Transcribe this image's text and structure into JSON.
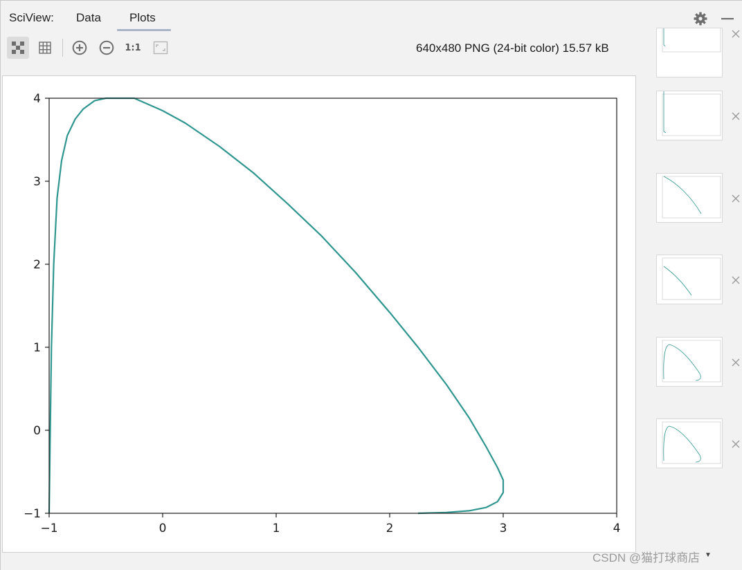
{
  "header": {
    "title": "SciView:",
    "tabs": [
      {
        "label": "Data",
        "active": false
      },
      {
        "label": "Plots",
        "active": true
      }
    ]
  },
  "toolbar": {
    "buttons": [
      {
        "icon": "checkerboard-icon",
        "active": true
      },
      {
        "icon": "grid-icon",
        "active": false
      },
      {
        "icon": "zoom-in-icon",
        "active": false
      },
      {
        "icon": "zoom-out-icon",
        "active": false
      },
      {
        "icon": "actual-size-icon",
        "label": "1:1",
        "active": false
      },
      {
        "icon": "fit-window-icon",
        "active": false
      }
    ],
    "image_info": "640x480 PNG (24-bit color) 15.57 kB"
  },
  "colors": {
    "accent": "#a9b4c6",
    "line": "#2e968f",
    "axis": "#1a1a1a",
    "icon": "#6e6e6e"
  },
  "chart_data": {
    "type": "line",
    "title": "",
    "xlabel": "",
    "ylabel": "",
    "xlim": [
      -1,
      4
    ],
    "ylim": [
      -1,
      4
    ],
    "xticks": [
      "−1",
      "0",
      "1",
      "2",
      "3",
      "4"
    ],
    "yticks": [
      "−1",
      "0",
      "1",
      "2",
      "3",
      "4"
    ],
    "grid": false,
    "series": [
      {
        "x": [
          -1.0,
          -0.99,
          -0.98,
          -0.96,
          -0.93,
          -0.89,
          -0.84,
          -0.77,
          -0.7,
          -0.6,
          -0.5,
          -0.25,
          0.0,
          0.2,
          0.5,
          0.8,
          1.1,
          1.4,
          1.7,
          2.0,
          2.25,
          2.5,
          2.7,
          2.85,
          2.95,
          3.0,
          3.0,
          2.95,
          2.85,
          2.7,
          2.5,
          2.25
        ],
        "y": [
          -1.0,
          0.0,
          1.0,
          2.0,
          2.8,
          3.25,
          3.55,
          3.75,
          3.87,
          3.97,
          4.0,
          4.0,
          3.85,
          3.7,
          3.42,
          3.1,
          2.73,
          2.34,
          1.9,
          1.42,
          1.0,
          0.55,
          0.15,
          -0.2,
          -0.45,
          -0.6,
          -0.75,
          -0.86,
          -0.93,
          -0.97,
          -0.99,
          -1.0
        ]
      }
    ]
  },
  "thumbnails": [
    {
      "id": 1,
      "shape": "empty-top"
    },
    {
      "id": 2,
      "shape": "empty"
    },
    {
      "id": 3,
      "shape": "descending"
    },
    {
      "id": 4,
      "shape": "descending-short"
    },
    {
      "id": 5,
      "shape": "loop"
    },
    {
      "id": 6,
      "shape": "loop"
    }
  ],
  "watermark": "CSDN @猫打球商店"
}
